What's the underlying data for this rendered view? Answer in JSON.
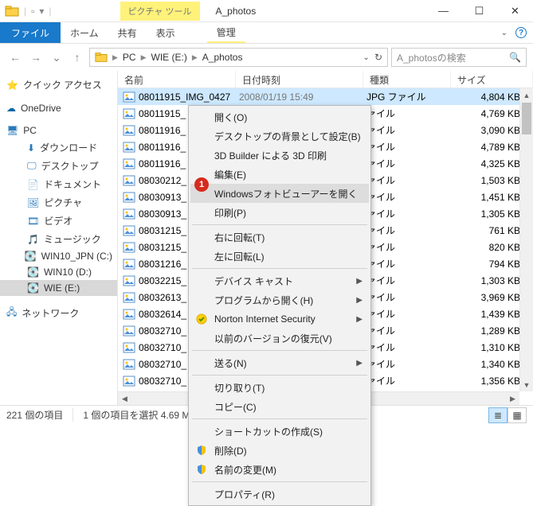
{
  "window": {
    "ctx_tab": "ピクチャ ツール",
    "title": "A_photos"
  },
  "ribbon": {
    "file": "ファイル",
    "home": "ホーム",
    "share": "共有",
    "view": "表示",
    "manage": "管理"
  },
  "address": {
    "crumbs": [
      "PC",
      "WIE (E:)",
      "A_photos"
    ],
    "search_placeholder": "A_photosの検索"
  },
  "nav": {
    "quick": "クイック アクセス",
    "onedrive": "OneDrive",
    "pc": "PC",
    "downloads": "ダウンロード",
    "desktop": "デスクトップ",
    "documents": "ドキュメント",
    "pictures": "ピクチャ",
    "videos": "ビデオ",
    "music": "ミュージック",
    "drive_c": "WIN10_JPN (C:)",
    "drive_d": "WIN10 (D:)",
    "drive_e": "WIE (E:)",
    "network": "ネットワーク"
  },
  "cols": {
    "name": "名前",
    "date": "日付時刻",
    "type": "種類",
    "size": "サイズ"
  },
  "file_type": "JPG ファイル",
  "file_type_short": "ァイル",
  "files": [
    {
      "n": "08011915_IMG_0427",
      "d": "2008/01/19 15:49",
      "s": "4,804 KB",
      "sel": true
    },
    {
      "n": "08011915_",
      "s": "4,769 KB"
    },
    {
      "n": "08011916_",
      "s": "3,090 KB"
    },
    {
      "n": "08011916_",
      "s": "4,789 KB"
    },
    {
      "n": "08011916_",
      "s": "4,325 KB"
    },
    {
      "n": "08030212_",
      "s": "1,503 KB"
    },
    {
      "n": "08030913_",
      "s": "1,451 KB"
    },
    {
      "n": "08030913_",
      "s": "1,305 KB"
    },
    {
      "n": "08031215_",
      "s": "761 KB"
    },
    {
      "n": "08031215_",
      "s": "820 KB"
    },
    {
      "n": "08031216_",
      "s": "794 KB"
    },
    {
      "n": "08032215_",
      "s": "1,303 KB"
    },
    {
      "n": "08032613_",
      "s": "3,969 KB"
    },
    {
      "n": "08032614_",
      "s": "1,439 KB"
    },
    {
      "n": "08032710_",
      "s": "1,289 KB"
    },
    {
      "n": "08032710_",
      "s": "1,310 KB"
    },
    {
      "n": "08032710_",
      "s": "1,340 KB"
    },
    {
      "n": "08032710_",
      "s": "1,356 KB"
    }
  ],
  "menu": {
    "open": "開く(O)",
    "set_bg": "デスクトップの背景として設定(B)",
    "print3d": "3D Builder による 3D 印刷",
    "edit": "編集(E)",
    "photo_viewer": "Windowsフォトビューアーを開く",
    "print": "印刷(P)",
    "rot_r": "右に回転(T)",
    "rot_l": "左に回転(L)",
    "cast": "デバイス キャスト",
    "open_with": "プログラムから開く(H)",
    "norton": "Norton Internet Security",
    "prev_ver": "以前のバージョンの復元(V)",
    "send_to": "送る(N)",
    "cut": "切り取り(T)",
    "copy": "コピー(C)",
    "shortcut": "ショートカットの作成(S)",
    "delete": "削除(D)",
    "rename": "名前の変更(M)",
    "props": "プロパティ(R)"
  },
  "status": {
    "count": "221 個の項目",
    "sel": "1 個の項目を選択 4.69 M"
  },
  "badge": "1"
}
